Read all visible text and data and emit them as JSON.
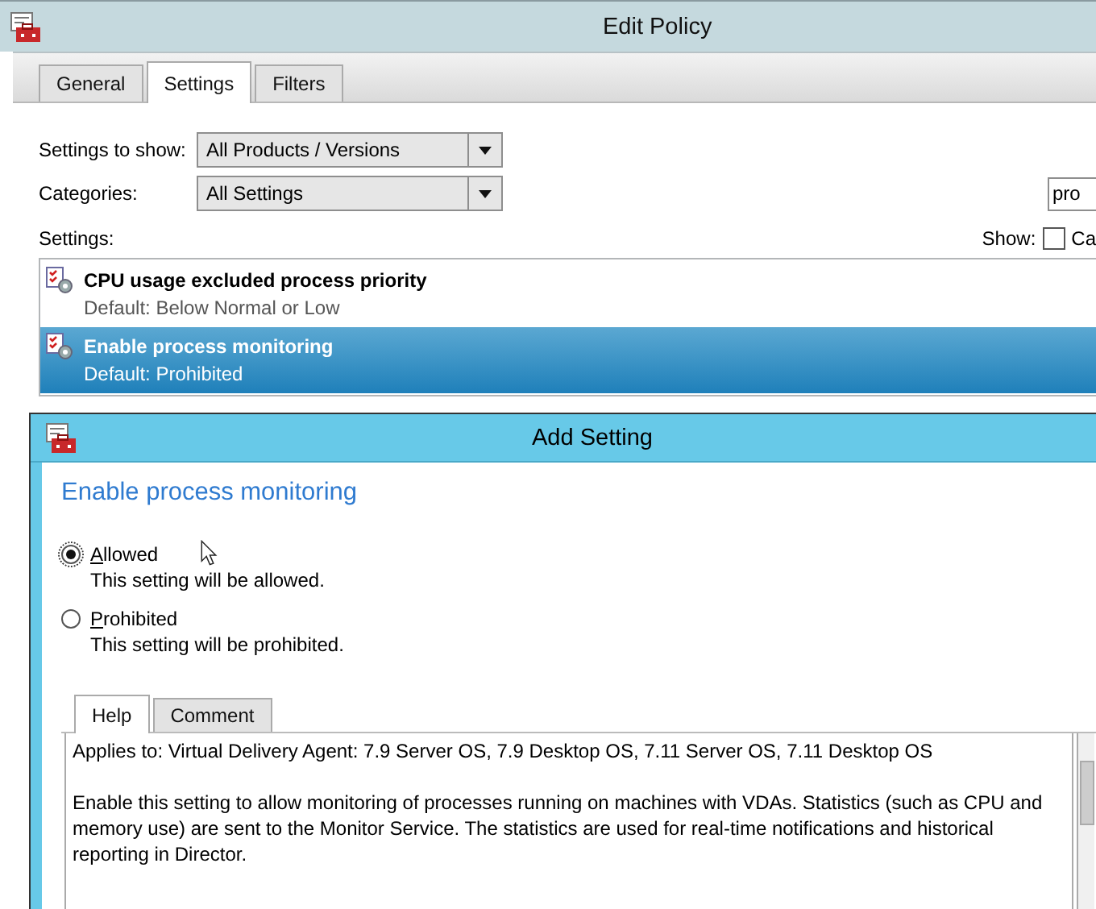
{
  "window": {
    "title": "Edit Policy"
  },
  "tabs": [
    {
      "label": "General",
      "selected": false
    },
    {
      "label": "Settings",
      "selected": true
    },
    {
      "label": "Filters",
      "selected": false
    }
  ],
  "settings_to_show": {
    "label": "Settings to show:",
    "value": "All Products / Versions"
  },
  "categories": {
    "label": "Categories:",
    "value": "All Settings"
  },
  "search": {
    "value": "pro"
  },
  "settings_label": "Settings:",
  "show": {
    "label": "Show:",
    "checked": false,
    "option": "Ca"
  },
  "settings": [
    {
      "name": "CPU usage excluded process priority",
      "default": "Default: Below Normal or Low",
      "selected": false
    },
    {
      "name": "Enable process monitoring",
      "default": "Default: Prohibited",
      "selected": true
    }
  ],
  "dialog": {
    "title": "Add Setting",
    "heading": "Enable process monitoring",
    "options": [
      {
        "label": "Allowed",
        "description": "This setting will be allowed.",
        "selected": true
      },
      {
        "label": "Prohibited",
        "description": "This setting will be prohibited.",
        "selected": false
      }
    ],
    "tabs": [
      {
        "label": "Help",
        "selected": true
      },
      {
        "label": "Comment",
        "selected": false
      }
    ],
    "help_text": [
      "Applies to: Virtual Delivery Agent: 7.9 Server OS, 7.9 Desktop OS, 7.11 Server OS, 7.11 Desktop OS",
      "Enable this setting to allow monitoring of processes running on machines with VDAs. Statistics (such as CPU and memory use) are sent to the Monitor Service. The statistics are used for real-time notifications and historical reporting in Director."
    ]
  }
}
